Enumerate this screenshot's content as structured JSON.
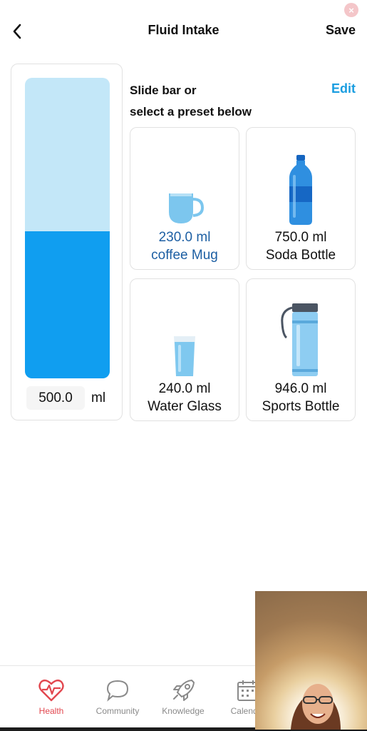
{
  "header": {
    "title": "Fluid Intake",
    "save_label": "Save",
    "close_glyph": "×"
  },
  "gauge": {
    "fill_fraction": 0.49,
    "empty_color": "#c3e7f8",
    "fill_color": "#109ef0",
    "amount": "500.0",
    "unit": "ml"
  },
  "instructions": {
    "line1": "Slide bar or",
    "line2": "select a preset below",
    "edit_label": "Edit"
  },
  "presets": [
    {
      "amount": "230.0 ml",
      "label": "coffee Mug",
      "icon": "mug-icon",
      "selected": true
    },
    {
      "amount": "750.0 ml",
      "label": "Soda Bottle",
      "icon": "soda-bottle-icon",
      "selected": false
    },
    {
      "amount": "240.0 ml",
      "label": "Water Glass",
      "icon": "water-glass-icon",
      "selected": false
    },
    {
      "amount": "946.0 ml",
      "label": "Sports Bottle",
      "icon": "sports-bottle-icon",
      "selected": false
    }
  ],
  "tabs": [
    {
      "label": "Health",
      "icon": "heart-pulse-icon",
      "active": true
    },
    {
      "label": "Community",
      "icon": "chat-bubble-icon",
      "active": false
    },
    {
      "label": "Knowledge",
      "icon": "rocket-icon",
      "active": false
    },
    {
      "label": "Calendar",
      "icon": "calendar-icon",
      "active": false
    }
  ],
  "colors": {
    "accent": "#1a9de0",
    "selected_text": "#1d5fa3",
    "active_tab": "#e2474f"
  }
}
